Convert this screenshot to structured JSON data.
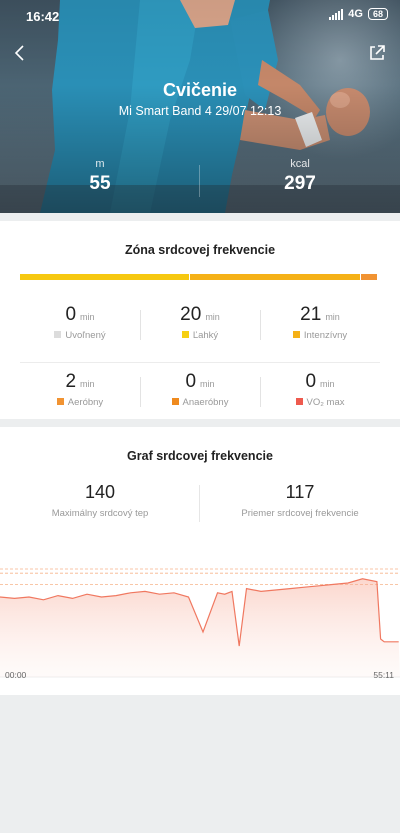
{
  "status_bar": {
    "time": "16:42",
    "network": "4G",
    "battery": "68"
  },
  "header": {
    "title": "Cvičenie",
    "subtitle": "Mi Smart Band 4 29/07 12:13"
  },
  "summary": {
    "distance": {
      "unit": "m",
      "value": "55"
    },
    "calories": {
      "unit": "kcal",
      "value": "297"
    }
  },
  "zones": {
    "title": "Zóna srdcovej frekvencie",
    "bar": [
      {
        "color": "#f6c810",
        "share": 21
      },
      {
        "color": "#f5b117",
        "share": 21
      },
      {
        "color": "#f19332",
        "share": 2
      }
    ],
    "items": [
      {
        "value": "0",
        "unit": "min",
        "label": "Uvoľnený",
        "color": "#dcdcdc"
      },
      {
        "value": "20",
        "unit": "min",
        "label": "Ľahký",
        "color": "#f6d012"
      },
      {
        "value": "21",
        "unit": "min",
        "label": "Intenzívny",
        "color": "#f5b117"
      },
      {
        "value": "2",
        "unit": "min",
        "label": "Aeróbny",
        "color": "#f19332"
      },
      {
        "value": "0",
        "unit": "min",
        "label": "Anaeróbny",
        "color": "#ef8a1e"
      },
      {
        "value": "0",
        "unit": "min",
        "label": "VO₂ max",
        "color": "#ee5a4e"
      }
    ]
  },
  "heart_rate": {
    "title": "Graf srdcovej frekvencie",
    "max": {
      "value": "140",
      "label": "Maximálny srdcový tep"
    },
    "avg": {
      "value": "117",
      "label": "Priemer srdcovej frekvencie"
    },
    "axis_start": "00:00",
    "axis_end": "55:11",
    "line_color": "#f07860",
    "chart_data": {
      "type": "area",
      "x_label_start": "00:00",
      "x_label_end": "55:11",
      "x_minutes": [
        0,
        2,
        4,
        6,
        8,
        10,
        12,
        14,
        16,
        18,
        20,
        22,
        24,
        26,
        28,
        30,
        31,
        32,
        33,
        34,
        36,
        38,
        40,
        42,
        44,
        46,
        48,
        50,
        52,
        52.5,
        53,
        55
      ],
      "bpm": [
        120,
        119,
        120,
        118,
        121,
        119,
        122,
        120,
        121,
        123,
        124,
        122,
        123,
        120,
        95,
        123,
        122,
        124,
        85,
        126,
        124,
        125,
        126,
        127,
        128,
        129,
        130,
        133,
        131,
        90,
        88,
        88
      ],
      "ylim": [
        70,
        140
      ],
      "guide_lines": [
        140,
        137,
        129
      ]
    }
  }
}
